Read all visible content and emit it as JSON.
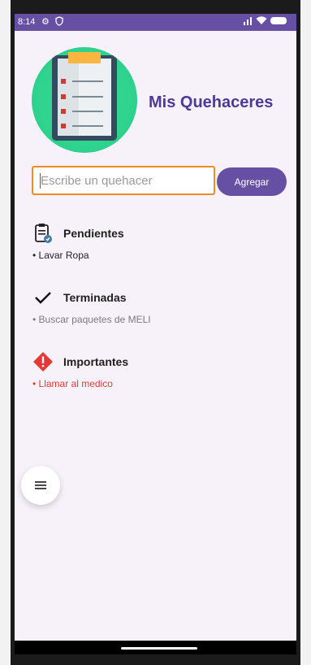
{
  "status_bar": {
    "time": "8:14",
    "color": "#6750a4"
  },
  "app": {
    "title": "Mis Quehaceres",
    "logo_icon": "clipboard-checklist-icon"
  },
  "form": {
    "input_placeholder": "Escribe un quehacer",
    "input_value": "",
    "add_label": "Agregar"
  },
  "sections": {
    "pending": {
      "title": "Pendientes",
      "icon": "clipboard-icon",
      "items": [
        "• Lavar Ropa"
      ],
      "color": "#1f1f1f"
    },
    "done": {
      "title": "Terminadas",
      "icon": "checkmark-icon",
      "items": [
        "• Buscar paquetes de MELI"
      ],
      "color": "#7a7a7a"
    },
    "important": {
      "title": "Importantes",
      "icon": "warning-diamond-icon",
      "items": [
        "• Llamar al medico"
      ],
      "color": "#e53935"
    }
  },
  "fab": {
    "icon": "menu-icon"
  },
  "colors": {
    "primary": "#6750a4",
    "title": "#4b3a96",
    "input_border": "#f08a24",
    "logo_bg": "#2fd48e"
  }
}
